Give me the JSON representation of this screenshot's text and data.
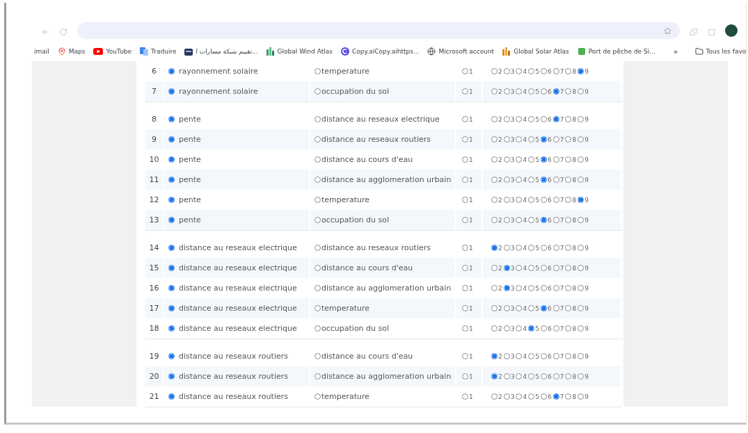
{
  "bookmarks": [
    {
      "kind": "mail",
      "label": "imail"
    },
    {
      "kind": "maps",
      "label": "Maps"
    },
    {
      "kind": "youtube",
      "label": "YouTube"
    },
    {
      "kind": "translate",
      "label": "Traduire"
    },
    {
      "kind": "building",
      "label": "تقييم شبكة مسارات ا..."
    },
    {
      "kind": "wind",
      "label": "Global Wind Atlas"
    },
    {
      "kind": "copyai",
      "label": "Copy.aiCopy.aihttps..."
    },
    {
      "kind": "globe",
      "label": "Microsoft account"
    },
    {
      "kind": "solar",
      "label": "Global Solar Atlas"
    },
    {
      "kind": "port",
      "label": "Port de pêche de Si..."
    }
  ],
  "bookmarks_more": "»",
  "all_bookmarks": "Tous les favo",
  "groups": [
    {
      "rows": [
        {
          "n": "6",
          "left": {
            "label": "rayonnement solaire",
            "selected": true
          },
          "right": {
            "label": "temperature",
            "selected": false
          },
          "scale": [
            {
              "label": "1",
              "selected": false
            },
            {
              "label": "2",
              "selected": false
            },
            {
              "label": "3",
              "selected": false
            },
            {
              "label": "4",
              "selected": false
            },
            {
              "label": "5",
              "selected": false
            },
            {
              "label": "6",
              "selected": false
            },
            {
              "label": "7",
              "selected": false
            },
            {
              "label": "8",
              "selected": false
            },
            {
              "label": "9",
              "selected": true
            }
          ]
        },
        {
          "n": "7",
          "left": {
            "label": "rayonnement solaire",
            "selected": true
          },
          "right": {
            "label": "occupation du sol",
            "selected": false
          },
          "scale": [
            {
              "label": "1",
              "selected": false
            },
            {
              "label": "2",
              "selected": false
            },
            {
              "label": "3",
              "selected": false
            },
            {
              "label": "4",
              "selected": false
            },
            {
              "label": "5",
              "selected": false
            },
            {
              "label": "6",
              "selected": false
            },
            {
              "label": "7",
              "selected": true
            },
            {
              "label": "8",
              "selected": false
            },
            {
              "label": "9",
              "selected": false
            }
          ]
        }
      ]
    },
    {
      "rows": [
        {
          "n": "8",
          "left": {
            "label": "pente",
            "selected": true
          },
          "right": {
            "label": "distance au reseaux electrique",
            "selected": false
          },
          "scale": [
            {
              "label": "1",
              "selected": false
            },
            {
              "label": "2",
              "selected": false
            },
            {
              "label": "3",
              "selected": false
            },
            {
              "label": "4",
              "selected": false
            },
            {
              "label": "5",
              "selected": false
            },
            {
              "label": "6",
              "selected": false
            },
            {
              "label": "7",
              "selected": true
            },
            {
              "label": "8",
              "selected": false
            },
            {
              "label": "9",
              "selected": false
            }
          ]
        },
        {
          "n": "9",
          "left": {
            "label": "pente",
            "selected": true
          },
          "right": {
            "label": "distance au reseaux routiers",
            "selected": false
          },
          "scale": [
            {
              "label": "1",
              "selected": false
            },
            {
              "label": "2",
              "selected": false
            },
            {
              "label": "3",
              "selected": false
            },
            {
              "label": "4",
              "selected": false
            },
            {
              "label": "5",
              "selected": false
            },
            {
              "label": "6",
              "selected": true
            },
            {
              "label": "7",
              "selected": false
            },
            {
              "label": "8",
              "selected": false
            },
            {
              "label": "9",
              "selected": false
            }
          ]
        },
        {
          "n": "10",
          "left": {
            "label": "pente",
            "selected": true
          },
          "right": {
            "label": "distance au cours d'eau",
            "selected": false
          },
          "scale": [
            {
              "label": "1",
              "selected": false
            },
            {
              "label": "2",
              "selected": false
            },
            {
              "label": "3",
              "selected": false
            },
            {
              "label": "4",
              "selected": false
            },
            {
              "label": "5",
              "selected": false
            },
            {
              "label": "6",
              "selected": true
            },
            {
              "label": "7",
              "selected": false
            },
            {
              "label": "8",
              "selected": false
            },
            {
              "label": "9",
              "selected": false
            }
          ]
        },
        {
          "n": "11",
          "left": {
            "label": "pente",
            "selected": true
          },
          "right": {
            "label": "distance au agglomeration urbain",
            "selected": false
          },
          "scale": [
            {
              "label": "1",
              "selected": false
            },
            {
              "label": "2",
              "selected": false
            },
            {
              "label": "3",
              "selected": false
            },
            {
              "label": "4",
              "selected": false
            },
            {
              "label": "5",
              "selected": false
            },
            {
              "label": "6",
              "selected": true
            },
            {
              "label": "7",
              "selected": false
            },
            {
              "label": "8",
              "selected": false
            },
            {
              "label": "9",
              "selected": false
            }
          ]
        },
        {
          "n": "12",
          "left": {
            "label": "pente",
            "selected": true
          },
          "right": {
            "label": "temperature",
            "selected": false
          },
          "scale": [
            {
              "label": "1",
              "selected": false
            },
            {
              "label": "2",
              "selected": false
            },
            {
              "label": "3",
              "selected": false
            },
            {
              "label": "4",
              "selected": false
            },
            {
              "label": "5",
              "selected": false
            },
            {
              "label": "6",
              "selected": false
            },
            {
              "label": "7",
              "selected": false
            },
            {
              "label": "8",
              "selected": false
            },
            {
              "label": "9",
              "selected": true
            }
          ]
        },
        {
          "n": "13",
          "left": {
            "label": "pente",
            "selected": true
          },
          "right": {
            "label": "occupation du sol",
            "selected": false
          },
          "scale": [
            {
              "label": "1",
              "selected": false
            },
            {
              "label": "2",
              "selected": false
            },
            {
              "label": "3",
              "selected": false
            },
            {
              "label": "4",
              "selected": false
            },
            {
              "label": "5",
              "selected": false
            },
            {
              "label": "6",
              "selected": true
            },
            {
              "label": "7",
              "selected": false
            },
            {
              "label": "8",
              "selected": false
            },
            {
              "label": "9",
              "selected": false
            }
          ]
        }
      ]
    },
    {
      "rows": [
        {
          "n": "14",
          "left": {
            "label": "distance au reseaux electrique",
            "selected": true
          },
          "right": {
            "label": "distance au reseaux routiers",
            "selected": false
          },
          "scale": [
            {
              "label": "1",
              "selected": false
            },
            {
              "label": "2",
              "selected": true
            },
            {
              "label": "3",
              "selected": false
            },
            {
              "label": "4",
              "selected": false
            },
            {
              "label": "5",
              "selected": false
            },
            {
              "label": "6",
              "selected": false
            },
            {
              "label": "7",
              "selected": false
            },
            {
              "label": "8",
              "selected": false
            },
            {
              "label": "9",
              "selected": false
            }
          ]
        },
        {
          "n": "15",
          "left": {
            "label": "distance au reseaux electrique",
            "selected": true
          },
          "right": {
            "label": "distance au cours d'eau",
            "selected": false
          },
          "scale": [
            {
              "label": "1",
              "selected": false
            },
            {
              "label": "2",
              "selected": false
            },
            {
              "label": "3",
              "selected": true
            },
            {
              "label": "4",
              "selected": false
            },
            {
              "label": "5",
              "selected": false
            },
            {
              "label": "6",
              "selected": false
            },
            {
              "label": "7",
              "selected": false
            },
            {
              "label": "8",
              "selected": false
            },
            {
              "label": "9",
              "selected": false
            }
          ]
        },
        {
          "n": "16",
          "left": {
            "label": "distance au reseaux electrique",
            "selected": true
          },
          "right": {
            "label": "distance au agglomeration urbain",
            "selected": false
          },
          "scale": [
            {
              "label": "1",
              "selected": false
            },
            {
              "label": "2",
              "selected": false
            },
            {
              "label": "3",
              "selected": true
            },
            {
              "label": "4",
              "selected": false
            },
            {
              "label": "5",
              "selected": false
            },
            {
              "label": "6",
              "selected": false
            },
            {
              "label": "7",
              "selected": false
            },
            {
              "label": "8",
              "selected": false
            },
            {
              "label": "9",
              "selected": false
            }
          ]
        },
        {
          "n": "17",
          "left": {
            "label": "distance au reseaux electrique",
            "selected": true
          },
          "right": {
            "label": "temperature",
            "selected": false
          },
          "scale": [
            {
              "label": "1",
              "selected": false
            },
            {
              "label": "2",
              "selected": false
            },
            {
              "label": "3",
              "selected": false
            },
            {
              "label": "4",
              "selected": false
            },
            {
              "label": "5",
              "selected": false
            },
            {
              "label": "6",
              "selected": true
            },
            {
              "label": "7",
              "selected": false
            },
            {
              "label": "8",
              "selected": false
            },
            {
              "label": "9",
              "selected": false
            }
          ]
        },
        {
          "n": "18",
          "left": {
            "label": "distance au reseaux electrique",
            "selected": true
          },
          "right": {
            "label": "occupation du sol",
            "selected": false
          },
          "scale": [
            {
              "label": "1",
              "selected": false
            },
            {
              "label": "2",
              "selected": false
            },
            {
              "label": "3",
              "selected": false
            },
            {
              "label": "4",
              "selected": false
            },
            {
              "label": "5",
              "selected": true
            },
            {
              "label": "6",
              "selected": false
            },
            {
              "label": "7",
              "selected": false
            },
            {
              "label": "8",
              "selected": false
            },
            {
              "label": "9",
              "selected": false
            }
          ]
        }
      ]
    },
    {
      "rows": [
        {
          "n": "19",
          "left": {
            "label": "distance au reseaux routiers",
            "selected": true
          },
          "right": {
            "label": "distance au cours d'eau",
            "selected": false
          },
          "scale": [
            {
              "label": "1",
              "selected": false
            },
            {
              "label": "2",
              "selected": true
            },
            {
              "label": "3",
              "selected": false
            },
            {
              "label": "4",
              "selected": false
            },
            {
              "label": "5",
              "selected": false
            },
            {
              "label": "6",
              "selected": false
            },
            {
              "label": "7",
              "selected": false
            },
            {
              "label": "8",
              "selected": false
            },
            {
              "label": "9",
              "selected": false
            }
          ]
        },
        {
          "n": "20",
          "left": {
            "label": "distance au reseaux routiers",
            "selected": true
          },
          "right": {
            "label": "distance au agglomeration urbain",
            "selected": false
          },
          "scale": [
            {
              "label": "1",
              "selected": false
            },
            {
              "label": "2",
              "selected": true
            },
            {
              "label": "3",
              "selected": false
            },
            {
              "label": "4",
              "selected": false
            },
            {
              "label": "5",
              "selected": false
            },
            {
              "label": "6",
              "selected": false
            },
            {
              "label": "7",
              "selected": false
            },
            {
              "label": "8",
              "selected": false
            },
            {
              "label": "9",
              "selected": false
            }
          ]
        },
        {
          "n": "21",
          "left": {
            "label": "distance au reseaux routiers",
            "selected": true
          },
          "right": {
            "label": "temperature",
            "selected": false
          },
          "scale": [
            {
              "label": "1",
              "selected": false
            },
            {
              "label": "2",
              "selected": false
            },
            {
              "label": "3",
              "selected": false
            },
            {
              "label": "4",
              "selected": false
            },
            {
              "label": "5",
              "selected": false
            },
            {
              "label": "6",
              "selected": false
            },
            {
              "label": "7",
              "selected": true
            },
            {
              "label": "8",
              "selected": false
            },
            {
              "label": "9",
              "selected": false
            }
          ]
        }
      ]
    }
  ]
}
